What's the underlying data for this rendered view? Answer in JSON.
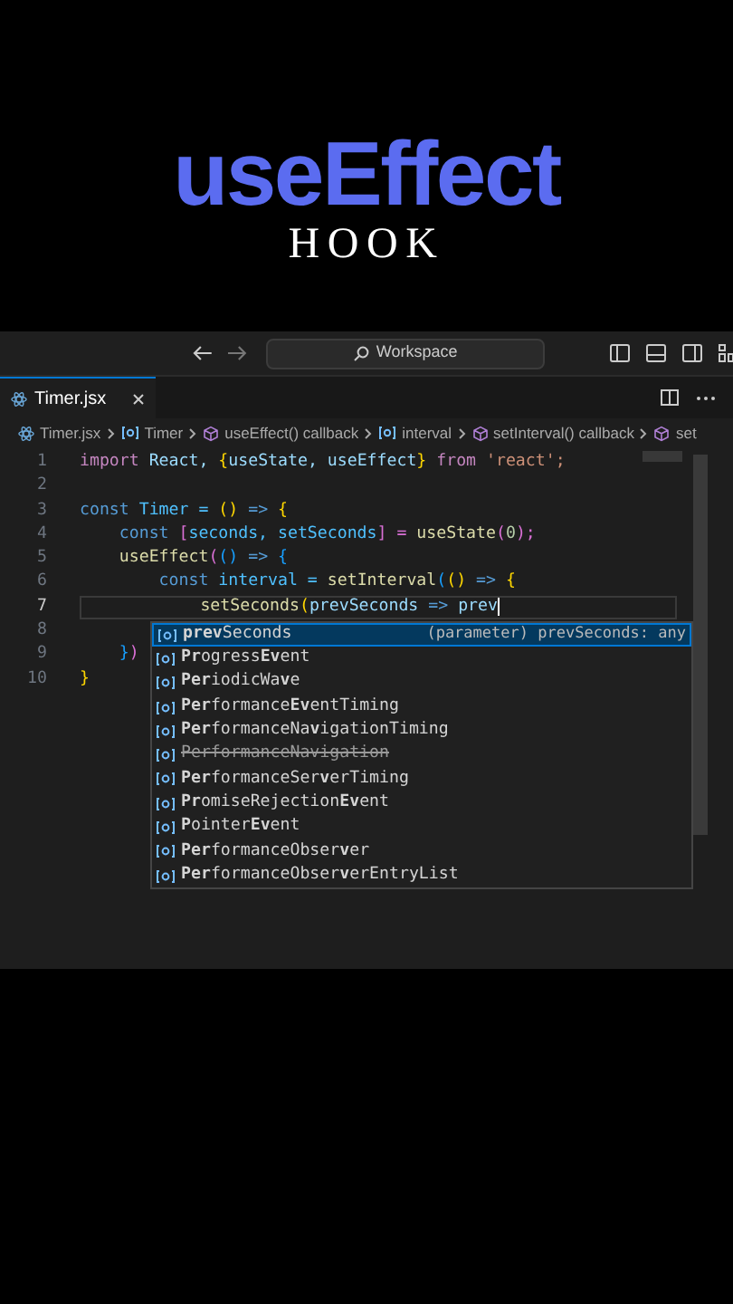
{
  "heading": {
    "title": "useEffect",
    "subtitle": "HOOK"
  },
  "titlebar": {
    "search": "Workspace"
  },
  "tabs": [
    {
      "label": "Timer.jsx",
      "selected": true
    }
  ],
  "breadcrumbs": [
    {
      "label": "Timer.jsx",
      "kind": "file"
    },
    {
      "label": "Timer",
      "kind": "variable"
    },
    {
      "label": "useEffect() callback",
      "kind": "method"
    },
    {
      "label": "interval",
      "kind": "variable"
    },
    {
      "label": "setInterval() callback",
      "kind": "method"
    },
    {
      "label": "set",
      "kind": "method"
    }
  ],
  "code": [
    {
      "number": "1",
      "current": false,
      "tokens": [
        {
          "text": "import",
          "color": "#c586c0"
        },
        {
          "text": " React,",
          "color": "#9cdcfe"
        },
        {
          "text": " {",
          "color": "#ffd700"
        },
        {
          "text": "useState, useEffect",
          "color": "#9cdcfe"
        },
        {
          "text": "}",
          "color": "#ffd700"
        },
        {
          "text": " from",
          "color": "#c586c0"
        },
        {
          "text": " 'react';",
          "color": "#ce9178"
        }
      ]
    },
    {
      "number": "2",
      "current": false
    },
    {
      "number": "3",
      "current": false,
      "tokens": [
        {
          "text": "const",
          "color": "#569cd6"
        },
        {
          "text": " Timer =",
          "color": "#4fc1ff"
        },
        {
          "text": " ()",
          "color": "#ffd700"
        },
        {
          "text": " =>",
          "color": "#569cd6"
        },
        {
          "text": " {",
          "color": "#ffd700"
        }
      ]
    },
    {
      "number": "4",
      "current": false,
      "tokens": [
        {
          "text": "    const",
          "color": "#569cd6"
        },
        {
          "text": " [",
          "color": "#da70d6"
        },
        {
          "text": "seconds, setSeconds",
          "color": "#4fc1ff"
        },
        {
          "text": "] =",
          "color": "#da70d6"
        },
        {
          "text": " useState",
          "color": "#dcdcaa"
        },
        {
          "text": "(",
          "color": "#da70d6"
        },
        {
          "text": "0",
          "color": "#b5cea8"
        },
        {
          "text": ");",
          "color": "#da70d6"
        }
      ]
    },
    {
      "number": "5",
      "current": false,
      "tokens": [
        {
          "text": "    useEffect",
          "color": "#dcdcaa"
        },
        {
          "text": "(",
          "color": "#da70d6"
        },
        {
          "text": "()",
          "color": "#179fff"
        },
        {
          "text": " =>",
          "color": "#569cd6"
        },
        {
          "text": " {",
          "color": "#179fff"
        }
      ]
    },
    {
      "number": "6",
      "current": false,
      "tokens": [
        {
          "text": "        const",
          "color": "#569cd6"
        },
        {
          "text": " interval =",
          "color": "#4fc1ff"
        },
        {
          "text": " setInterval",
          "color": "#dcdcaa"
        },
        {
          "text": "(",
          "color": "#179fff"
        },
        {
          "text": "()",
          "color": "#ffd700"
        },
        {
          "text": " =>",
          "color": "#569cd6"
        },
        {
          "text": " {",
          "color": "#ffd700"
        }
      ]
    },
    {
      "number": "7",
      "current": true,
      "tokens": [
        {
          "text": "            setSeconds",
          "color": "#dcdcaa"
        },
        {
          "text": "(",
          "color": "#ffd700"
        },
        {
          "text": "prevSeconds",
          "color": "#9cdcfe"
        },
        {
          "text": " =>",
          "color": "#569cd6"
        },
        {
          "text": " prev",
          "color": "#9cdcfe"
        }
      ]
    },
    {
      "number": "8",
      "current": false
    },
    {
      "number": "9",
      "current": false,
      "tokens": [
        {
          "text": "    }",
          "color": "#179fff"
        },
        {
          "text": ")",
          "color": "#da70d6"
        }
      ]
    },
    {
      "number": "10",
      "current": false,
      "tokens": [
        {
          "text": "}",
          "color": "#ffd700"
        }
      ]
    }
  ],
  "suggestions": [
    {
      "selected": true,
      "deprecated": false,
      "label": "**prev**Seconds",
      "detail": "(parameter) prevSeconds: any"
    },
    {
      "selected": false,
      "deprecated": false,
      "label": "**Pr**ogress**Ev**ent"
    },
    {
      "selected": false,
      "deprecated": false,
      "label": "**Per**iodicWa**v**e"
    },
    {
      "selected": false,
      "deprecated": false,
      "label": "**Per**formance**Ev**entTiming"
    },
    {
      "selected": false,
      "deprecated": false,
      "label": "**Per**formanceNa**v**igationTiming"
    },
    {
      "selected": false,
      "deprecated": true,
      "label": "PerformanceNavigation"
    },
    {
      "selected": false,
      "deprecated": false,
      "label": "**Per**formanceSer**v**erTiming"
    },
    {
      "selected": false,
      "deprecated": false,
      "label": "**Pr**omiseRejection**Ev**ent"
    },
    {
      "selected": false,
      "deprecated": false,
      "label": "**P**ointer**Ev**ent"
    },
    {
      "selected": false,
      "deprecated": false,
      "label": "**Per**formanceObser**v**er"
    },
    {
      "selected": false,
      "deprecated": false,
      "label": "**Per**formanceObser**v**erEntryList"
    }
  ]
}
